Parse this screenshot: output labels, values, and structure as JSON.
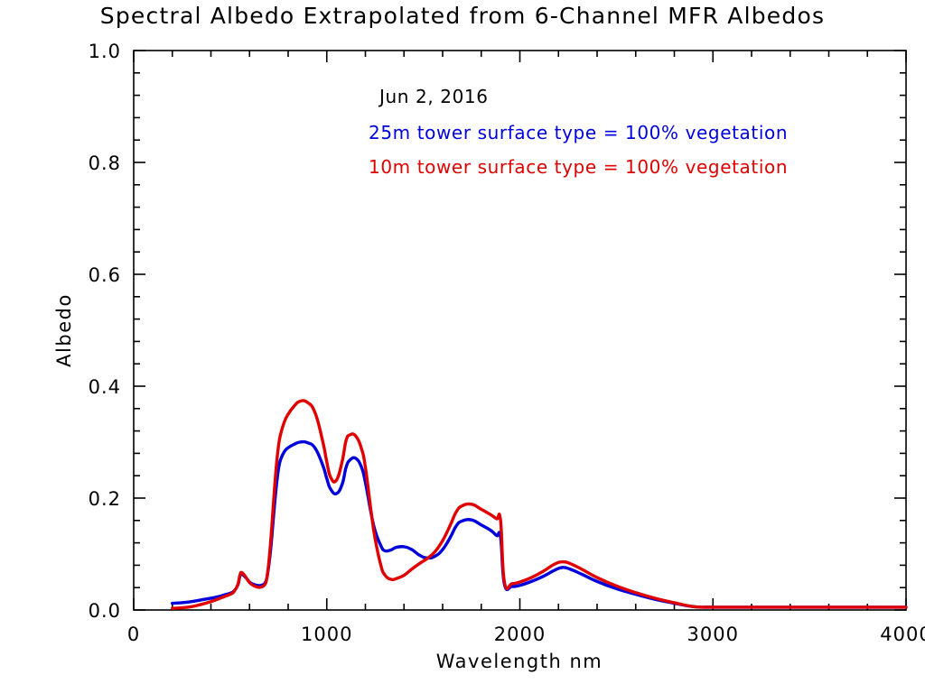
{
  "figure": {
    "title": "Spectral Albedo Extrapolated from 6-Channel MFR Albedos",
    "background_color": "#ffffff",
    "foreground_color": "#000000"
  },
  "annotations": {
    "date": "Jun 2, 2016",
    "series_25m": "25m tower surface type = 100% vegetation",
    "series_10m": "10m tower surface type = 100% vegetation"
  },
  "axis_labels": {
    "x_title": "Wavelength nm",
    "y_title": "Albedo",
    "x_ticks": [
      "0",
      "1000",
      "2000",
      "3000",
      "4000"
    ],
    "y_ticks": [
      "0.0",
      "0.2",
      "0.4",
      "0.6",
      "0.8",
      "1.0"
    ]
  },
  "colors": {
    "blue": "#0000dd",
    "red": "#e00000",
    "axis": "#000000"
  },
  "chart_data": {
    "type": "line",
    "title": "Spectral Albedo Extrapolated from 6-Channel MFR Albedos",
    "subtitle": "Jun 2, 2016",
    "xlabel": "Wavelength nm",
    "ylabel": "Albedo",
    "xlim": [
      0,
      4000
    ],
    "ylim": [
      0.0,
      1.0
    ],
    "x_major_tick_interval": 1000,
    "y_major_tick_interval": 0.2,
    "x_minor_ticks_per_major": 5,
    "y_minor_ticks_per_major": 4,
    "grid": false,
    "legend_position": "top-center-inside",
    "series": [
      {
        "name": "25m tower surface type = 100% vegetation",
        "label": "25m tower surface type = 100% vegetation",
        "color": "#0000dd",
        "x": [
          200,
          250,
          300,
          350,
          400,
          440,
          470,
          500,
          520,
          540,
          550,
          560,
          580,
          600,
          620,
          640,
          660,
          680,
          690,
          700,
          710,
          720,
          730,
          740,
          750,
          760,
          780,
          800,
          830,
          860,
          900,
          940,
          980,
          1000,
          1020,
          1050,
          1080,
          1100,
          1120,
          1150,
          1180,
          1200,
          1230,
          1250,
          1280,
          1300,
          1330,
          1360,
          1400,
          1440,
          1480,
          1520,
          1560,
          1600,
          1640,
          1670,
          1700,
          1750,
          1800,
          1850,
          1880,
          1900,
          1920,
          1960,
          2000,
          2060,
          2120,
          2180,
          2220,
          2260,
          2320,
          2400,
          2500,
          2600,
          2700,
          2800,
          2900,
          3000,
          3200,
          3400,
          3600,
          3800,
          4000
        ],
        "y": [
          0.012,
          0.013,
          0.015,
          0.018,
          0.021,
          0.024,
          0.027,
          0.03,
          0.034,
          0.045,
          0.06,
          0.064,
          0.058,
          0.05,
          0.046,
          0.044,
          0.044,
          0.048,
          0.058,
          0.08,
          0.11,
          0.15,
          0.19,
          0.225,
          0.252,
          0.268,
          0.283,
          0.29,
          0.296,
          0.3,
          0.299,
          0.289,
          0.258,
          0.235,
          0.216,
          0.208,
          0.225,
          0.255,
          0.268,
          0.271,
          0.255,
          0.228,
          0.172,
          0.142,
          0.115,
          0.106,
          0.107,
          0.112,
          0.113,
          0.108,
          0.098,
          0.093,
          0.096,
          0.108,
          0.13,
          0.15,
          0.159,
          0.161,
          0.152,
          0.142,
          0.133,
          0.13,
          0.046,
          0.042,
          0.044,
          0.051,
          0.06,
          0.071,
          0.076,
          0.073,
          0.064,
          0.051,
          0.038,
          0.028,
          0.019,
          0.012,
          0.006,
          0.005,
          0.005,
          0.005,
          0.005,
          0.005,
          0.005
        ]
      },
      {
        "name": "10m tower surface type = 100% vegetation",
        "label": "10m tower surface type = 100% vegetation",
        "color": "#e00000",
        "x": [
          200,
          250,
          300,
          350,
          400,
          440,
          470,
          500,
          520,
          540,
          550,
          560,
          580,
          600,
          620,
          640,
          660,
          680,
          690,
          700,
          710,
          720,
          730,
          740,
          750,
          760,
          780,
          800,
          830,
          860,
          900,
          940,
          980,
          1000,
          1020,
          1050,
          1080,
          1100,
          1120,
          1150,
          1180,
          1200,
          1230,
          1250,
          1280,
          1300,
          1330,
          1360,
          1400,
          1440,
          1480,
          1520,
          1560,
          1600,
          1640,
          1670,
          1700,
          1750,
          1800,
          1850,
          1880,
          1900,
          1920,
          1960,
          2000,
          2060,
          2120,
          2180,
          2220,
          2260,
          2320,
          2400,
          2500,
          2600,
          2700,
          2800,
          2900,
          3000,
          3200,
          3400,
          3600,
          3800,
          4000
        ],
        "y": [
          0.003,
          0.004,
          0.006,
          0.01,
          0.015,
          0.02,
          0.024,
          0.028,
          0.033,
          0.046,
          0.062,
          0.067,
          0.059,
          0.049,
          0.044,
          0.041,
          0.041,
          0.046,
          0.058,
          0.086,
          0.125,
          0.172,
          0.22,
          0.262,
          0.293,
          0.313,
          0.336,
          0.35,
          0.364,
          0.373,
          0.371,
          0.352,
          0.3,
          0.265,
          0.237,
          0.232,
          0.266,
          0.303,
          0.313,
          0.311,
          0.288,
          0.255,
          0.175,
          0.128,
          0.08,
          0.063,
          0.055,
          0.056,
          0.062,
          0.073,
          0.083,
          0.092,
          0.104,
          0.124,
          0.152,
          0.175,
          0.186,
          0.189,
          0.18,
          0.17,
          0.163,
          0.16,
          0.05,
          0.047,
          0.05,
          0.058,
          0.069,
          0.082,
          0.086,
          0.083,
          0.073,
          0.058,
          0.043,
          0.031,
          0.021,
          0.013,
          0.006,
          0.005,
          0.005,
          0.005,
          0.005,
          0.005,
          0.005
        ]
      }
    ]
  }
}
